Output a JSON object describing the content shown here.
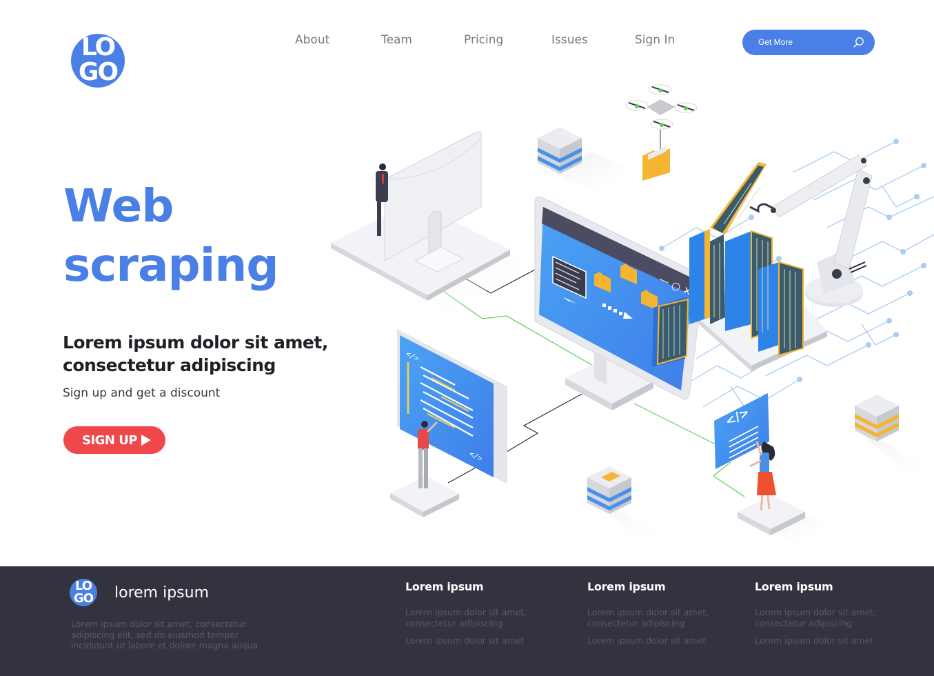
{
  "brand": {
    "logo_line1": "LO",
    "logo_line2": "GO",
    "accent_color": "#4a80e6",
    "cta_color": "#f0474a",
    "footer_bg": "#33323f"
  },
  "nav": {
    "items": [
      {
        "label": "About"
      },
      {
        "label": "Team"
      },
      {
        "label": "Pricing"
      },
      {
        "label": "Issues"
      },
      {
        "label": "Sign In"
      }
    ]
  },
  "search": {
    "label": "Get More",
    "icon": "search-icon"
  },
  "hero": {
    "title_line1": "Web",
    "title_line2": "scraping",
    "subtitle_line1": "Lorem ipsum dolor sit amet,",
    "subtitle_line2": "consectetur adipiscing",
    "note": "Sign up and get a discount",
    "cta_label": "SIGN UP",
    "cta_icon": "play-icon"
  },
  "illustration": {
    "description": "Isometric web scraping scene: monitors, servers, robot arm, drone carrying folder, people working with code screens",
    "screen_controls": [
      "minimize",
      "maximize",
      "close"
    ],
    "code_tag": "</>"
  },
  "footer": {
    "logo_line1": "LO",
    "logo_line2": "GO",
    "brand": "lorem ipsum",
    "description": "Lorem ipsum dolor sit amet, consectetur adipiscing elit, sed do eiusmod tempor incididunt ut labore et dolore magna aliqua.",
    "columns": [
      {
        "heading": "Lorem ipsum",
        "links": [
          "Lorem ipsum dolor sit amet, consectetur adipiscing",
          "Lorem ipsum dolor sit amet"
        ]
      },
      {
        "heading": "Lorem ipsum",
        "links": [
          "Lorem ipsum dolor sit amet, consectetur adipiscing",
          "Lorem ipsum dolor sit amet"
        ]
      },
      {
        "heading": "Lorem ipsum",
        "links": [
          "Lorem ipsum dolor sit amet, consectetur adipiscing",
          "Lorem ipsum dolor sit amet"
        ]
      }
    ]
  }
}
